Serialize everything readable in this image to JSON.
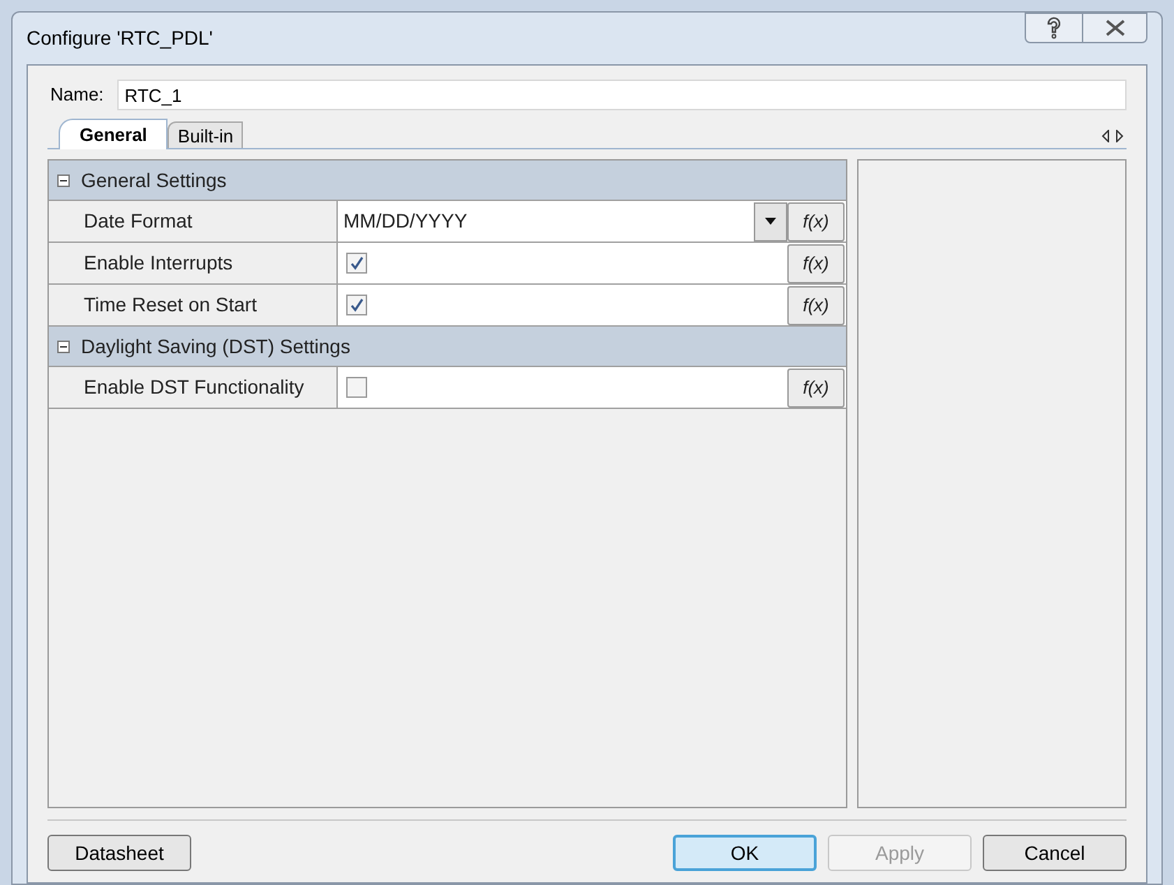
{
  "window": {
    "title": "Configure 'RTC_PDL'"
  },
  "name_field": {
    "label": "Name:",
    "value": "RTC_1"
  },
  "tabs": [
    {
      "label": "General",
      "selected": true
    },
    {
      "label": "Built-in",
      "selected": false
    }
  ],
  "categories": [
    {
      "title": "General Settings",
      "expanded": true,
      "rows": [
        {
          "label": "Date Format",
          "kind": "dropdown",
          "value": "MM/DD/YYYY",
          "fx": "f(x)"
        },
        {
          "label": "Enable Interrupts",
          "kind": "checkbox",
          "checked": true,
          "fx": "f(x)"
        },
        {
          "label": "Time Reset on Start",
          "kind": "checkbox",
          "checked": true,
          "fx": "f(x)"
        }
      ]
    },
    {
      "title": "Daylight Saving (DST) Settings",
      "expanded": true,
      "rows": [
        {
          "label": "Enable DST Functionality",
          "kind": "checkbox",
          "checked": false,
          "fx": "f(x)"
        }
      ]
    }
  ],
  "buttons": [
    {
      "label": "Datasheet",
      "disabled": false,
      "default": false
    },
    {
      "label": "OK",
      "disabled": false,
      "default": true
    },
    {
      "label": "Apply",
      "disabled": true,
      "default": false
    },
    {
      "label": "Cancel",
      "disabled": false,
      "default": false
    }
  ]
}
